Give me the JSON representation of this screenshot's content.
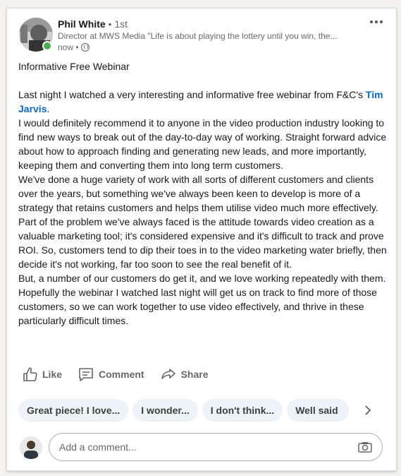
{
  "author": {
    "name": "Phil White",
    "degree": "• 1st",
    "headline": "Director at MWS Media \"Life is about playing the lottery until you win, the...",
    "time": "now •",
    "visibility_icon": "globe-icon",
    "presence_color": "#4caf50"
  },
  "post": {
    "title": "Informative Free Webinar",
    "intro": "Last night I watched a very interesting and informative free webinar from F&C's",
    "mention": "Tim Jarvis",
    "mention_suffix": ".",
    "paragraphs": [
      "I would definitely recommend it to anyone in the video production industry looking to find new ways to break out of the day-to-day way of working. Straight forward advice about how to approach finding and generating new leads, and more importantly, keeping them and converting them into long term customers.",
      "We've done a huge variety of work with all sorts of different customers and clients over the years, but something we've always been keen to develop is more of a strategy that retains customers and helps them utilise video much more effectively.",
      "Part of the problem we've always faced is the attitude towards video creation as a valuable marketing tool; it's considered expensive and it's difficult to track and prove ROI.  So, customers tend to dip their toes in to the video marketing water briefly, then decide it's not working, far too soon to see the real benefit of it.",
      "But, a number of our customers do get it, and we love working repeatedly with them.  Hopefully the webinar I watched last night will get us on track to find more of those customers, so we can work together to use video effectively, and thrive in these particularly difficult times."
    ],
    "mention_color": "#0a66c2"
  },
  "actions": {
    "like": "Like",
    "comment": "Comment",
    "share": "Share"
  },
  "suggestions": [
    "Great piece! I love...",
    "I wonder...",
    "I don't think...",
    "Well said"
  ],
  "comment_input": {
    "placeholder": "Add a comment..."
  }
}
